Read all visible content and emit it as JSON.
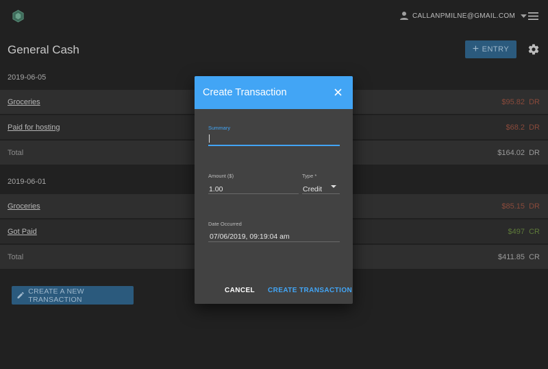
{
  "header": {
    "user_email": "CALLANPMILNE@GMAIL.COM"
  },
  "page": {
    "title": "General Cash",
    "entry_button": "ENTRY"
  },
  "groups": [
    {
      "date": "2019-06-05",
      "rows": [
        {
          "name": "Groceries",
          "amount": "$95.82",
          "type": "DR"
        },
        {
          "name": "Paid for hosting",
          "amount": "$68.2",
          "type": "DR"
        }
      ],
      "total_label": "Total",
      "total_amount": "$164.02",
      "total_type": "DR"
    },
    {
      "date": "2019-06-01",
      "rows": [
        {
          "name": "Groceries",
          "amount": "$85.15",
          "type": "DR"
        },
        {
          "name": "Got Paid",
          "amount": "$497",
          "type": "CR"
        }
      ],
      "total_label": "Total",
      "total_amount": "$411.85",
      "total_type": "CR"
    }
  ],
  "create_new_button": "CREATE A NEW TRANSACTION",
  "dialog": {
    "title": "Create Transaction",
    "summary_label": "Summary",
    "summary_value": "",
    "amount_label": "Amount ($)",
    "amount_value": "1.00",
    "type_label": "Type *",
    "type_value": "Credit",
    "date_label": "Date Occurred",
    "date_value": "07/06/2019, 09:19:04 am",
    "cancel_button": "CANCEL",
    "create_button": "CREATE TRANSACTION"
  },
  "colors": {
    "accent": "#42a5f5",
    "button_dim": "#2b5a7d",
    "debit": "#8a4a3b",
    "credit": "#5e7a3a"
  },
  "icons": [
    "app-logo-icon",
    "account-icon",
    "chevron-down-icon",
    "hamburger-menu-icon",
    "gear-icon",
    "plus-icon",
    "pencil-icon",
    "close-icon",
    "dropdown-arrow-icon"
  ]
}
